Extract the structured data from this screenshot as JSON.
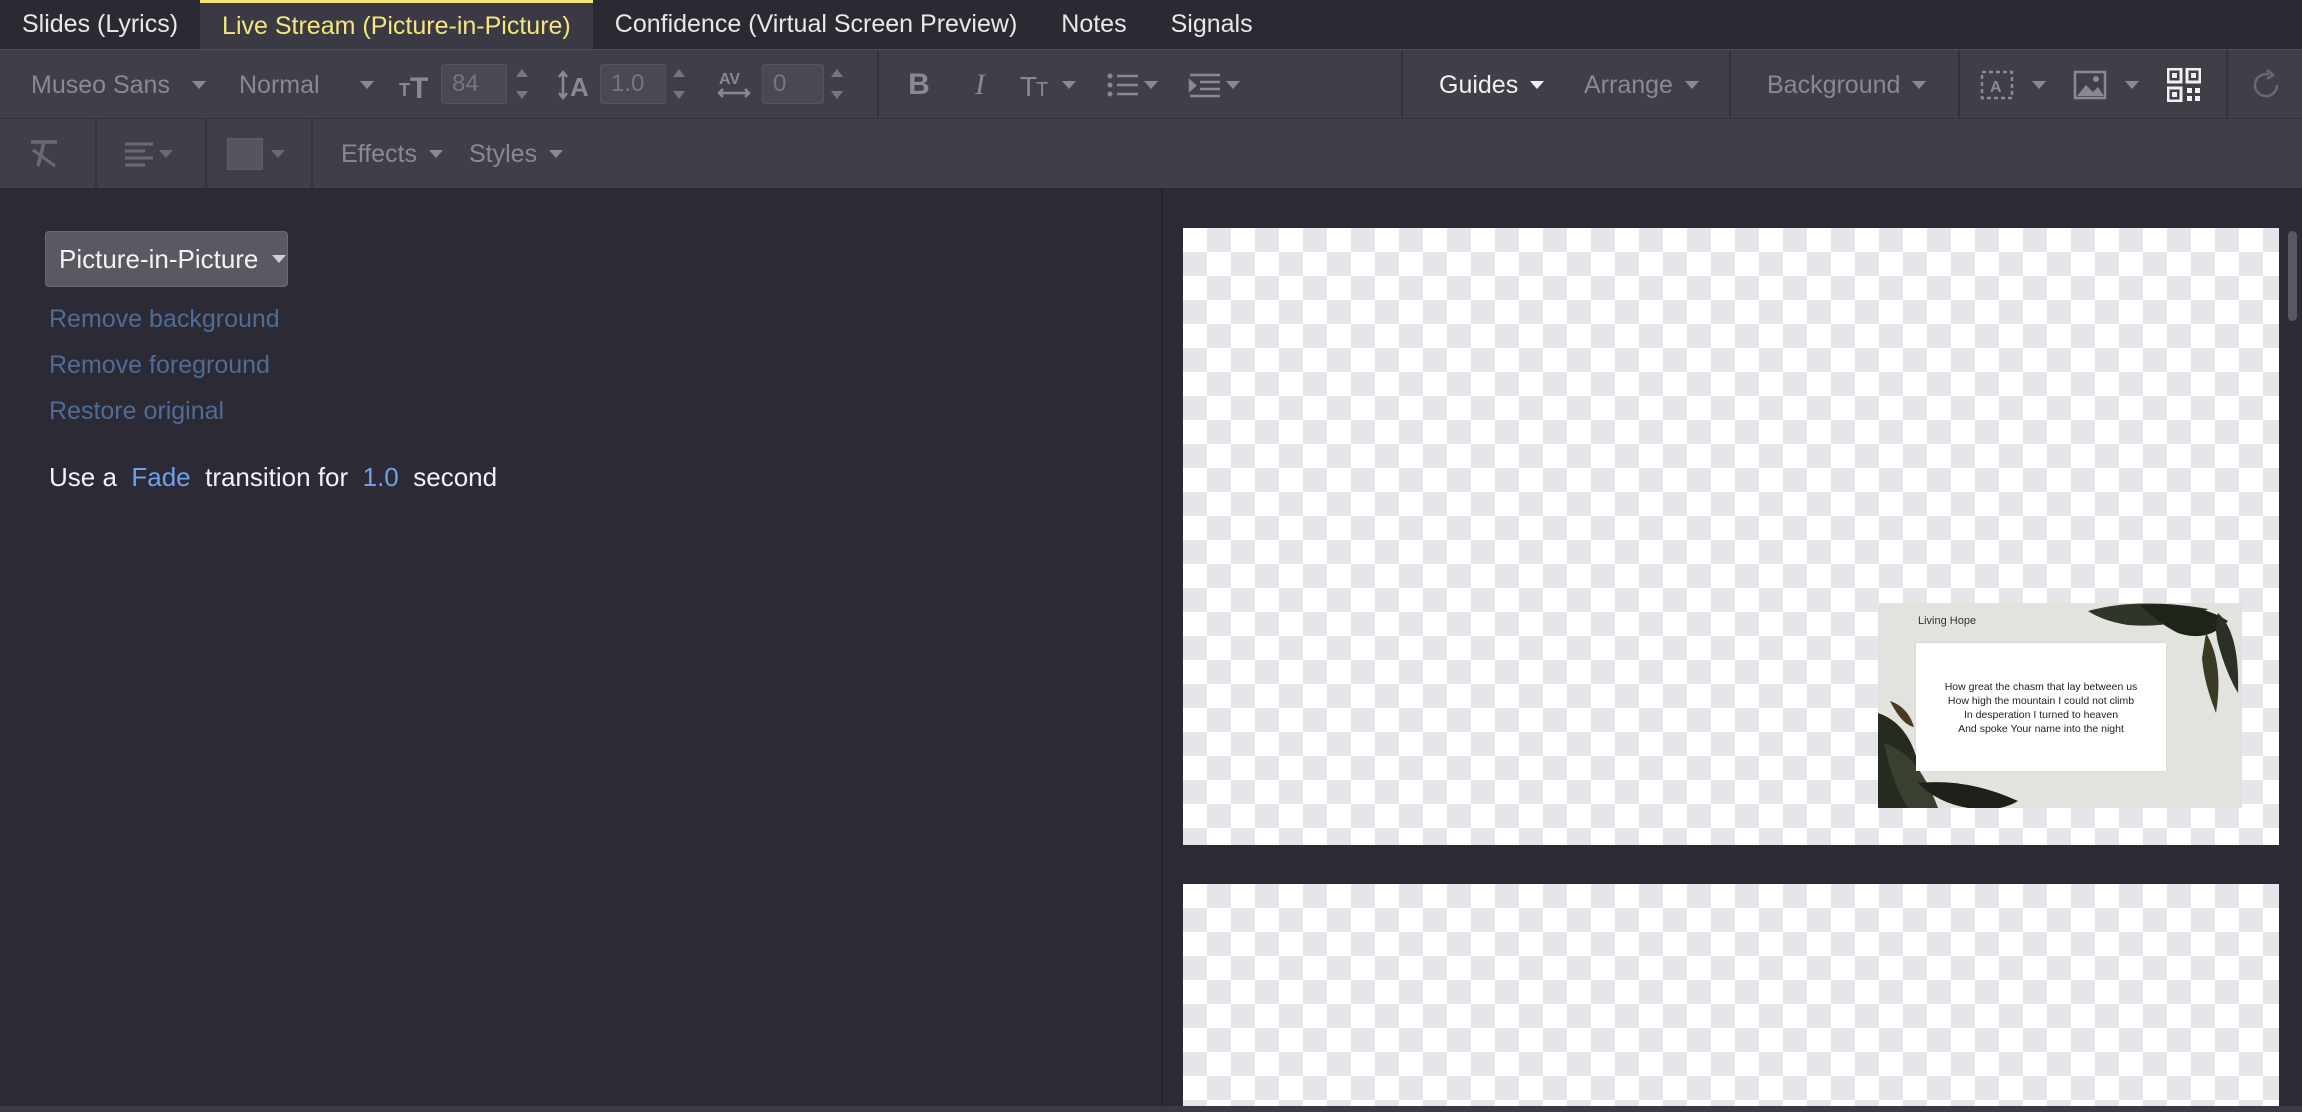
{
  "tabs": [
    {
      "label": "Slides (Lyrics)",
      "active": false
    },
    {
      "label": "Live Stream (Picture-in-Picture)",
      "active": true
    },
    {
      "label": "Confidence (Virtual Screen Preview)",
      "active": false
    },
    {
      "label": "Notes",
      "active": false
    },
    {
      "label": "Signals",
      "active": false
    }
  ],
  "toolbar": {
    "font_family": "Museo Sans",
    "font_weight": "Normal",
    "font_size": "84",
    "line_height": "1.0",
    "letter_spacing": "0",
    "guides_label": "Guides",
    "arrange_label": "Arrange",
    "background_label": "Background",
    "effects_label": "Effects",
    "styles_label": "Styles"
  },
  "left_panel": {
    "layout_dropdown": "Picture-in-Picture",
    "links": [
      "Remove background",
      "Remove foreground",
      "Restore original"
    ],
    "transition": {
      "prefix": "Use a",
      "effect": "Fade",
      "middle": "transition for",
      "duration": "1.0",
      "suffix": "second"
    }
  },
  "preview": {
    "slide_title": "Living Hope",
    "lyrics": [
      "How great the chasm that lay between us",
      "How high the mountain I could not climb",
      "In desperation I turned to heaven",
      "And spoke Your name into the night"
    ]
  },
  "colors": {
    "active_tab": "#f3e67a",
    "link": "#4f6c95",
    "highlight": "#6fa0ea",
    "background": "#2c2b35"
  }
}
